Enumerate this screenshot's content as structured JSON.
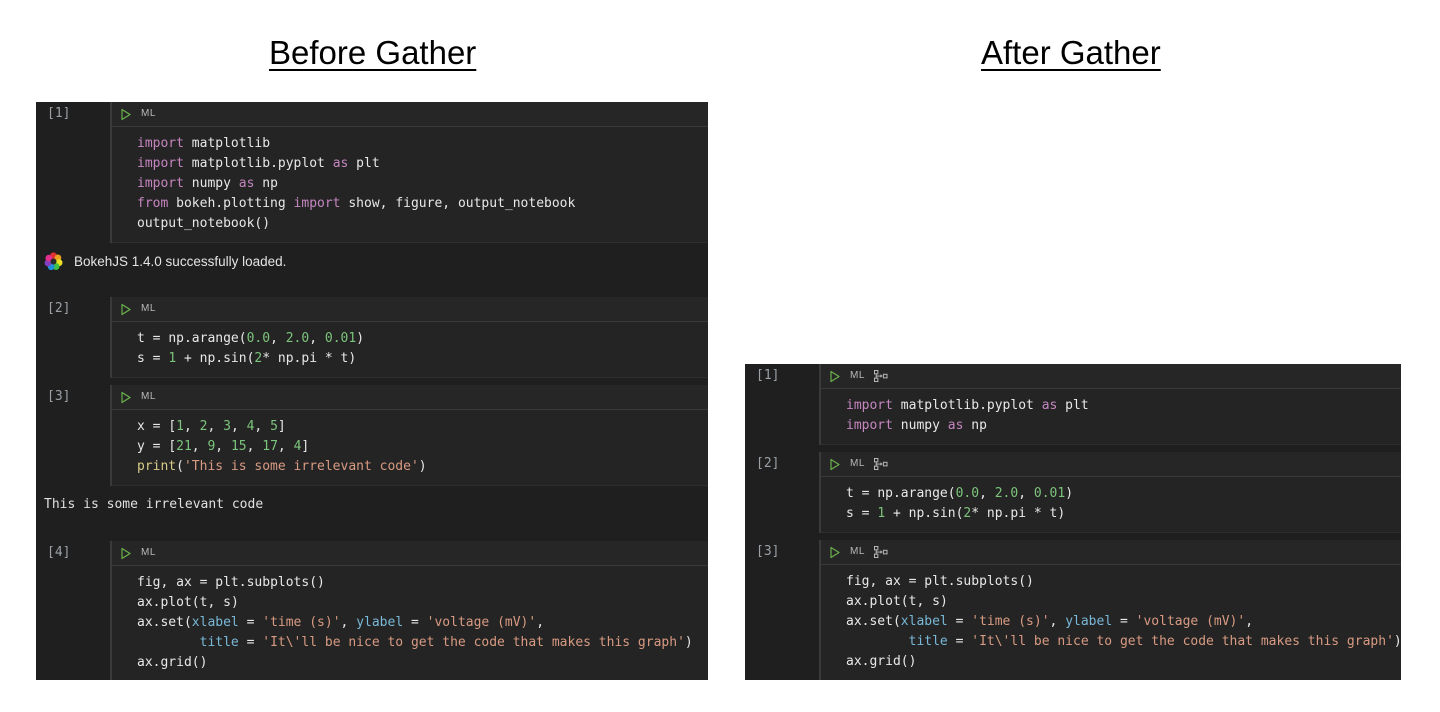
{
  "headings": {
    "before": "Before Gather",
    "after": "After Gather"
  },
  "icons": {
    "run": "play-icon",
    "ml_badge": "ML",
    "gather": "gather-icon",
    "bokeh_logo": "bokeh-logo-icon"
  },
  "colors": {
    "background": "#ffffff",
    "notebook_bg": "#1f1f1f",
    "code_bg": "#242424",
    "toolbar_bg": "#262626",
    "keyword": "#c586c0",
    "number": "#7cc47c",
    "string": "#d89a82",
    "builtin": "#d7cb8a",
    "kwarg": "#79b8d8",
    "text": "#e8e8e8",
    "run_green": "#6ab04c",
    "gutter_text": "#9aa0a6"
  },
  "before_gather": {
    "cells": [
      {
        "prompt": "[1]",
        "has_gather_icon": false,
        "code": [
          "import matplotlib",
          "import matplotlib.pyplot as plt",
          "import numpy as np",
          "from bokeh.plotting import show, figure, output_notebook",
          "output_notebook()"
        ],
        "output_type": "rich",
        "output_text": "BokehJS 1.4.0 successfully loaded."
      },
      {
        "prompt": "[2]",
        "has_gather_icon": false,
        "code": [
          "t = np.arange(0.0, 2.0, 0.01)",
          "s = 1 + np.sin(2* np.pi * t)"
        ],
        "output_type": "none",
        "output_text": ""
      },
      {
        "prompt": "[3]",
        "has_gather_icon": false,
        "code": [
          "x = [1, 2, 3, 4, 5]",
          "y = [21, 9, 15, 17, 4]",
          "print('This is some irrelevant code')"
        ],
        "output_type": "text",
        "output_text": "This is some irrelevant code"
      },
      {
        "prompt": "[4]",
        "has_gather_icon": false,
        "code": [
          "fig, ax = plt.subplots()",
          "ax.plot(t, s)",
          "ax.set(xlabel = 'time (s)', ylabel = 'voltage (mV)',",
          "        title = 'It\\'ll be nice to get the code that makes this graph')",
          "ax.grid()"
        ],
        "output_type": "none",
        "output_text": ""
      }
    ]
  },
  "after_gather": {
    "cells": [
      {
        "prompt": "[1]",
        "has_gather_icon": true,
        "code": [
          "import matplotlib.pyplot as plt",
          "import numpy as np"
        ],
        "output_type": "none",
        "output_text": ""
      },
      {
        "prompt": "[2]",
        "has_gather_icon": true,
        "code": [
          "t = np.arange(0.0, 2.0, 0.01)",
          "s = 1 + np.sin(2* np.pi * t)"
        ],
        "output_type": "none",
        "output_text": ""
      },
      {
        "prompt": "[3]",
        "has_gather_icon": true,
        "code": [
          "fig, ax = plt.subplots()",
          "ax.plot(t, s)",
          "ax.set(xlabel = 'time (s)', ylabel = 'voltage (mV)',",
          "        title = 'It\\'ll be nice to get the code that makes this graph')",
          "ax.grid()"
        ],
        "output_type": "none",
        "output_text": ""
      }
    ]
  }
}
